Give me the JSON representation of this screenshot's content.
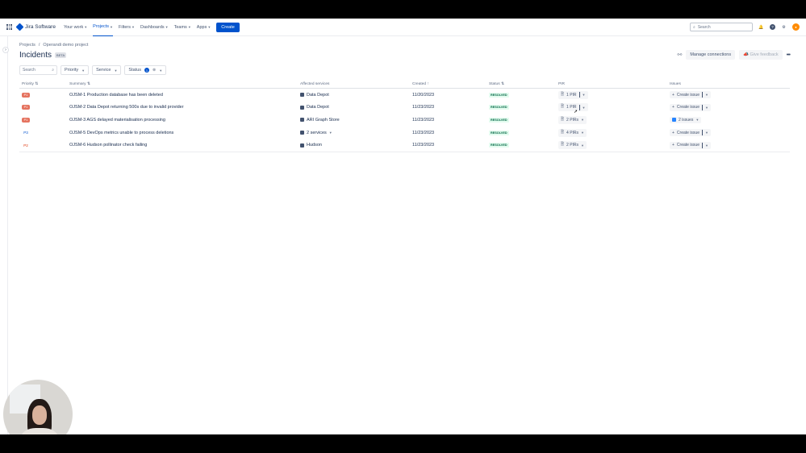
{
  "nav": {
    "brand": "Jira Software",
    "items": [
      "Your work",
      "Projects",
      "Filters",
      "Dashboards",
      "Teams",
      "Apps"
    ],
    "create": "Create",
    "search_placeholder": "Search"
  },
  "breadcrumb": {
    "projects": "Projects",
    "sep": "/",
    "project": "Operandi demo project"
  },
  "title": "Incidents",
  "beta": "BETA",
  "actions": {
    "manage": "Manage connections",
    "feedback": "Give feedback",
    "more": "•••"
  },
  "filters": {
    "search_placeholder": "Search",
    "priority": "Priority",
    "service": "Service",
    "status": "Status",
    "status_count": "1"
  },
  "columns": {
    "priority": "Priority",
    "summary": "Summary",
    "services": "Affected services",
    "created": "Created",
    "status": "Status",
    "pir": "PIR",
    "issues": "Issues"
  },
  "rows": [
    {
      "priority": "P1",
      "key": "OJSM-1",
      "summary": "Production database has been deleted",
      "service": "Data Depot",
      "created": "11/20/2023",
      "status": "RESOLVED",
      "pir": "1 PIR",
      "issues": "Create issue"
    },
    {
      "priority": "P1",
      "key": "OJSM-2",
      "summary": "Data Depot returning 500s due to invalid provider",
      "service": "Data Depot",
      "created": "11/23/2023",
      "status": "RESOLVED",
      "pir": "1 PIR",
      "issues": "Create issue"
    },
    {
      "priority": "P1",
      "key": "OJSM-3",
      "summary": "AGS delayed materialisation processing",
      "service": "ARI Graph Store",
      "created": "11/23/2023",
      "status": "RESOLVED",
      "pir": "2 PIRs",
      "issues": "2 issues"
    },
    {
      "priority": "P3",
      "key": "OJSM-5",
      "summary": "DevOps metrics unable to process deletions",
      "service": "2 services",
      "created": "11/23/2023",
      "status": "RESOLVED",
      "pir": "4 PIRs",
      "issues": "Create issue"
    },
    {
      "priority": "P2",
      "key": "OJSM-6",
      "summary": "Hudson pollinator check failing",
      "service": "Hudson",
      "created": "11/23/2023",
      "status": "RESOLVED",
      "pir": "2 PIRs",
      "issues": "Create issue"
    }
  ]
}
